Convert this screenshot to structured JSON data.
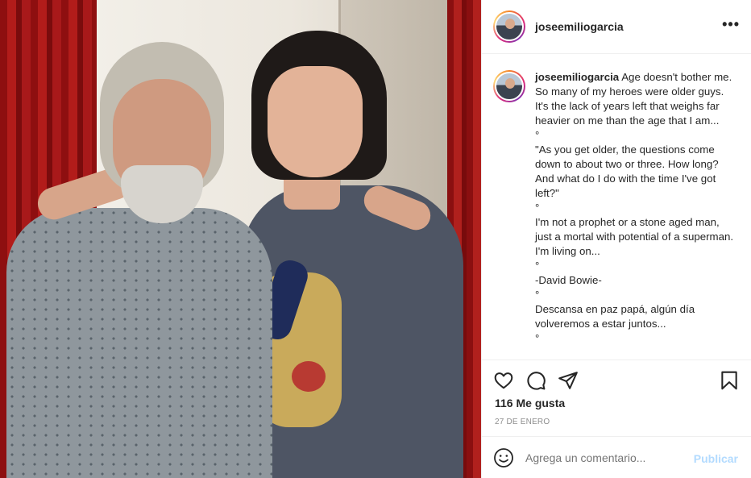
{
  "post": {
    "photo_icon": "photo-of-two-people",
    "username": "joseemiliogarcia",
    "more_icon": "more-options-icon"
  },
  "caption": {
    "username": "joseemiliogarcia",
    "lines": [
      "Age doesn't bother me. So many of my heroes were older guys. It's the lack of years left that weighs far heavier on me than the age that I am...",
      "°",
      "\"As you get older, the questions come down to about two or three. How long? And what do I do with the time I've got left?\"",
      "°",
      "I'm not a prophet or a stone aged man, just a mortal with potential of a superman. I'm living on...",
      "°",
      "-David Bowie-",
      "°",
      "Descansa en paz papá, algún día volveremos a estar juntos...",
      "°"
    ]
  },
  "actions": {
    "icons": [
      "heart-icon",
      "comment-icon",
      "share-icon",
      "bookmark-icon"
    ]
  },
  "likes_text": "116 Me gusta",
  "date_text": "27 DE ENERO",
  "comment": {
    "placeholder": "Agrega un comentario...",
    "publish_label": "Publicar",
    "emoji_icon": "emoji-icon"
  },
  "colors": {
    "primary_text": "#262626",
    "secondary_text": "#8e8e8e",
    "publish_disabled": "#b3dbff",
    "divider": "#efefef"
  }
}
